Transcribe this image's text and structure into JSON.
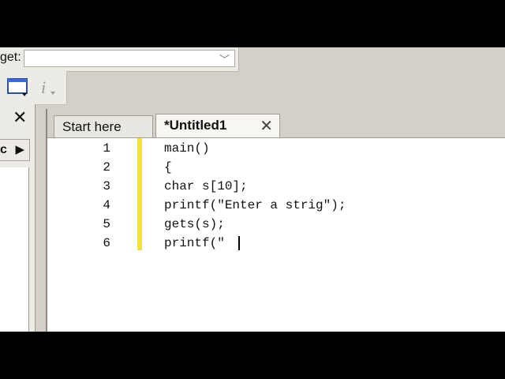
{
  "target": {
    "label": "get:",
    "value": ""
  },
  "toolbar": {
    "buttons": [
      "window-icon",
      "info-icon"
    ]
  },
  "left_panel": {
    "close_glyph": "✕",
    "tab_label": "c",
    "tab_arrow": "▶"
  },
  "tabs": [
    {
      "label": "Start here",
      "active": false
    },
    {
      "label": "*Untitled1",
      "active": true
    }
  ],
  "tab_close_glyph": "✕",
  "editor": {
    "lines": [
      {
        "num": "1",
        "text": "main()"
      },
      {
        "num": "2",
        "text": "{"
      },
      {
        "num": "3",
        "text": "char s[10];"
      },
      {
        "num": "4",
        "text": "printf(\"Enter a strig\");"
      },
      {
        "num": "5",
        "text": "gets(s);"
      },
      {
        "num": "6",
        "text": "printf(\""
      }
    ],
    "modified_marker_color": "#f0e040"
  }
}
